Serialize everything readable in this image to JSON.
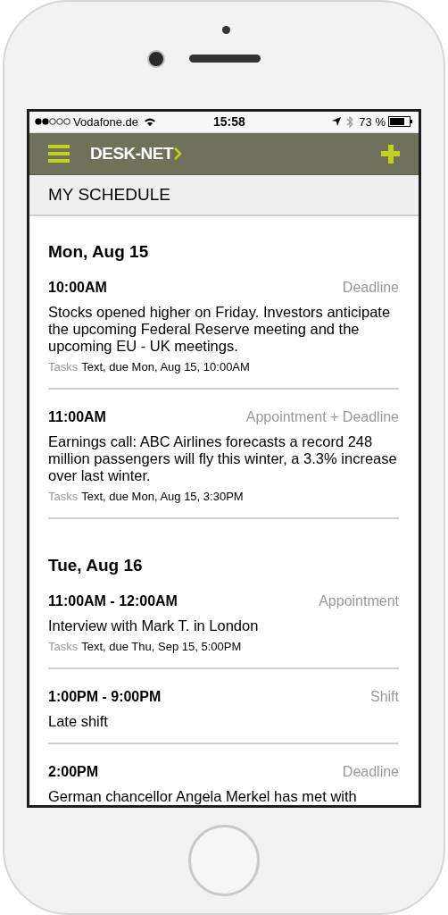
{
  "status_bar": {
    "carrier": "Vodafone.de",
    "time": "15:58",
    "battery": "73 %"
  },
  "nav_bar": {
    "logo": "DESK-NET"
  },
  "page_title": "MY SCHEDULE",
  "days": [
    {
      "date": "Mon, Aug 15",
      "events": [
        {
          "time": "10:00AM",
          "type": "Deadline",
          "description": "Stocks opened higher on Friday. Investors anticipate the upcoming Federal Reserve meeting and the upcoming EU - UK meetings.",
          "task_label": "Tasks",
          "task": "Text, due Mon, Aug 15, 10:00AM"
        },
        {
          "time": "11:00AM",
          "type": "Appointment + Deadline",
          "description": "Earnings call: ABC Airlines forecasts a record 248 million passengers will fly this winter, a 3.3% increase over last winter.",
          "task_label": "Tasks",
          "task": "Text, due Mon, Aug 15, 3:30PM"
        }
      ]
    },
    {
      "date": "Tue, Aug 16",
      "events": [
        {
          "time": "11:00AM - 12:00AM",
          "type": "Appointment",
          "description": "Interview with Mark T. in London",
          "task_label": "Tasks",
          "task": "Text, due Thu, Sep 15, 5:00PM"
        },
        {
          "time": "1:00PM - 9:00PM",
          "type": "Shift",
          "description": "Late shift"
        },
        {
          "time": "2:00PM",
          "type": "Deadline",
          "description": "German chancellor Angela Merkel has met with"
        }
      ]
    }
  ]
}
